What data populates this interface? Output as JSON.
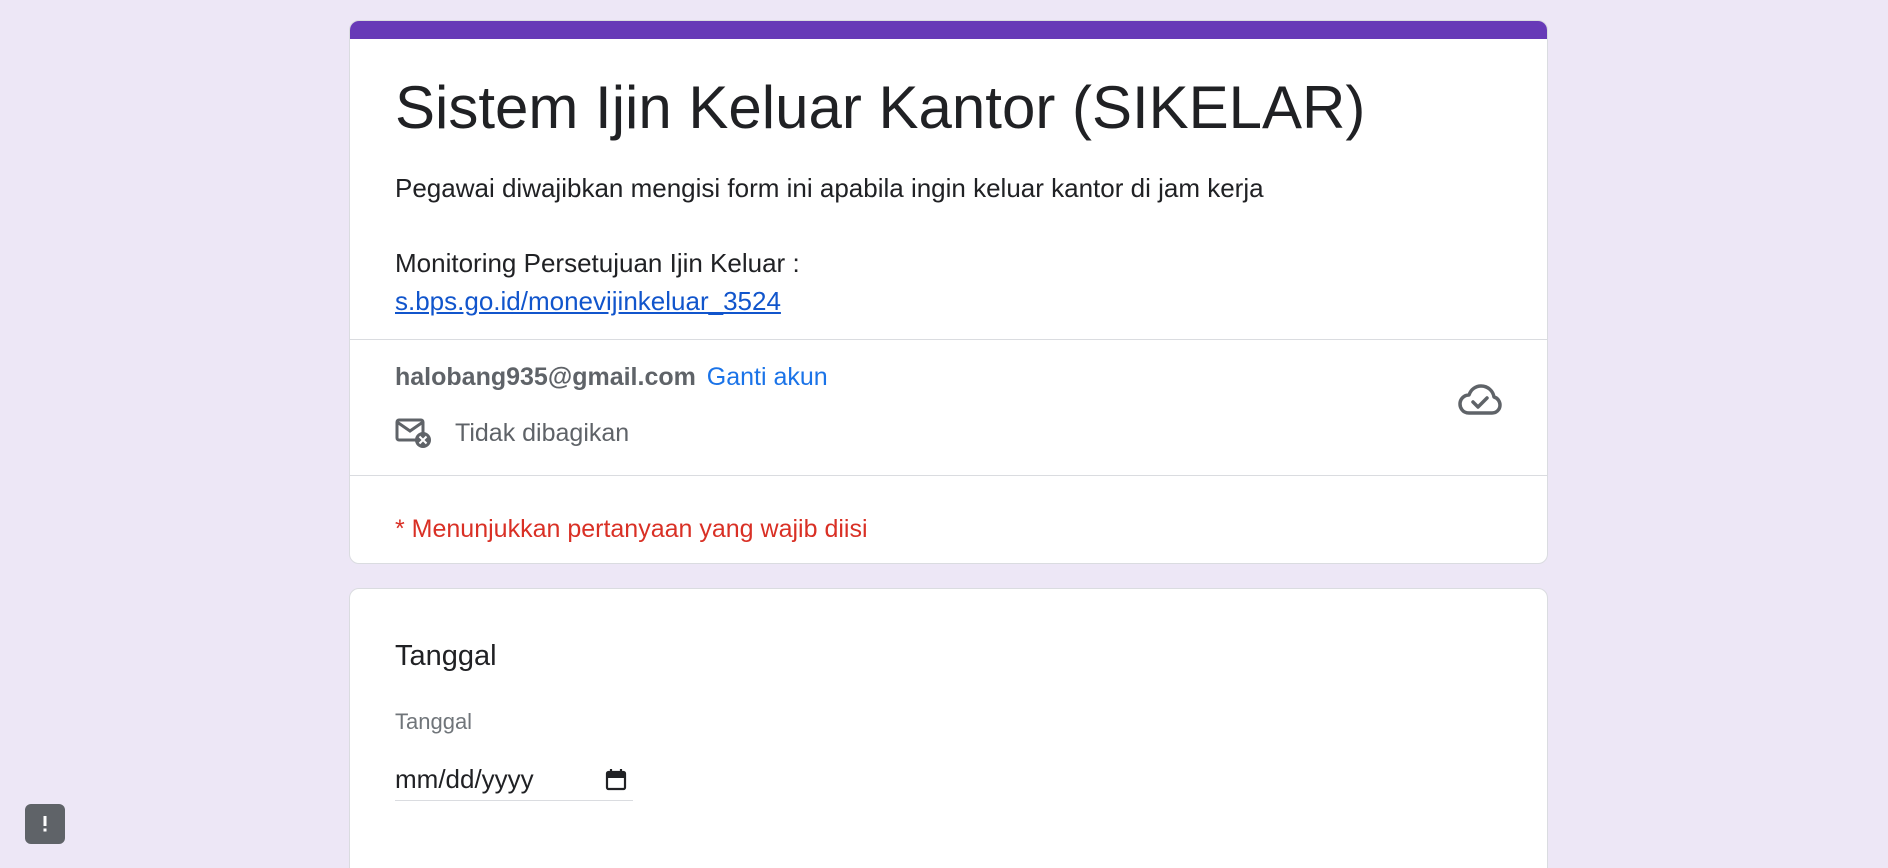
{
  "form": {
    "title": "Sistem Ijin Keluar Kantor (SIKELAR)",
    "description_line1": "Pegawai diwajibkan mengisi form ini apabila ingin keluar kantor di jam kerja",
    "description_line2": "Monitoring Persetujuan Ijin Keluar :",
    "monitoring_link": "s.bps.go.id/monevijinkeluar_3524",
    "accent_color": "#673ab7"
  },
  "account": {
    "email": "halobang935@gmail.com",
    "switch_label": "Ganti akun",
    "share_status": "Tidak dibagikan"
  },
  "required_note": "* Menunjukkan pertanyaan yang wajib diisi",
  "question": {
    "title": "Tanggal",
    "sublabel": "Tanggal",
    "date_placeholder": "mm/dd/yyyy"
  },
  "icons": {
    "share": "mail-not-shared-icon",
    "cloud": "cloud-saved-icon",
    "calendar": "calendar-icon",
    "feedback": "report-problem-icon"
  }
}
